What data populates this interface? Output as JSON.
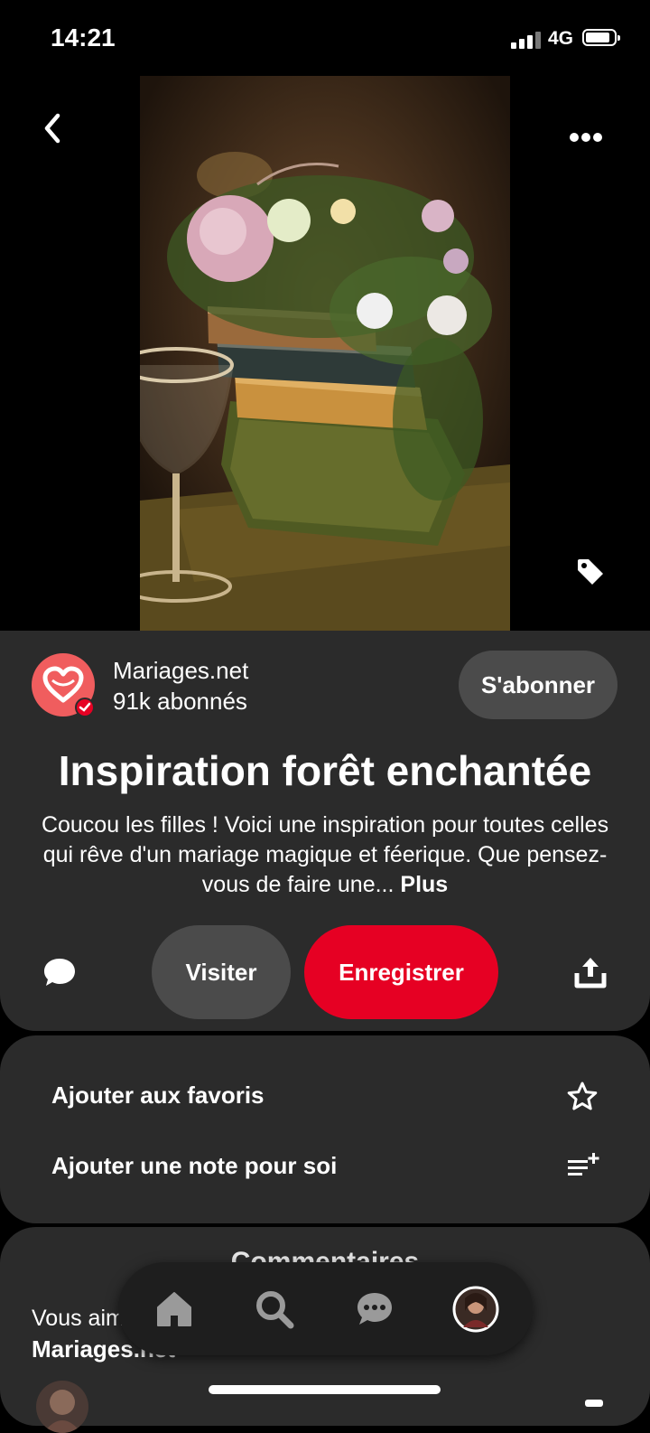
{
  "status_bar": {
    "time": "14:21",
    "network": "4G"
  },
  "pin": {
    "image_icon": "tag-icon"
  },
  "publisher": {
    "name": "Mariages.net",
    "followers": "91k abonnés",
    "follow_label": "S'abonner"
  },
  "title": "Inspiration forêt enchantée",
  "description": "Coucou les filles ! Voici une inspiration pour toutes celles qui rêve d'un mariage magique et féerique. Que pensez-vous de faire une...",
  "more_label": "Plus",
  "actions": {
    "visit_label": "Visiter",
    "save_label": "Enregistrer"
  },
  "options": {
    "favorites_label": "Ajouter aux favoris",
    "note_label": "Ajouter une note pour soi"
  },
  "comments": {
    "heading": "Commentaires",
    "prompt": "Vous aimez ce Pin ?",
    "user": "Mariages.net ?"
  },
  "nav": {
    "items": [
      "home-icon",
      "search-icon",
      "messages-icon",
      "profile-avatar"
    ]
  },
  "colors": {
    "accent": "#e60023",
    "card_bg": "#2b2b2b",
    "pill_bg": "#4b4b4b",
    "brand": "#f05d5e"
  }
}
